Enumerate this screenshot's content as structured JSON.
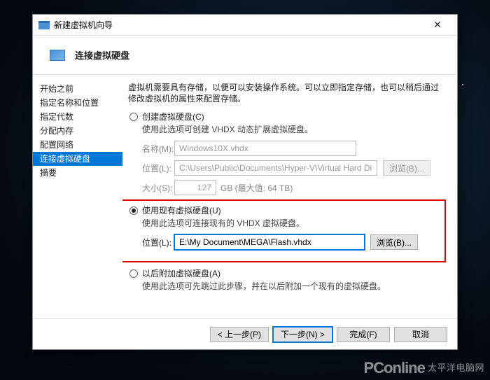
{
  "window": {
    "title": "新建虚拟机向导"
  },
  "header": {
    "title": "连接虚拟硬盘"
  },
  "sidebar": {
    "items": [
      {
        "label": "开始之前"
      },
      {
        "label": "指定名称和位置"
      },
      {
        "label": "指定代数"
      },
      {
        "label": "分配内存"
      },
      {
        "label": "配置网络"
      },
      {
        "label": "连接虚拟硬盘"
      },
      {
        "label": "摘要"
      }
    ]
  },
  "content": {
    "description": "虚拟机需要具有存储，以便可以安装操作系统。可以立即指定存储，也可以稍后通过修改虚拟机的属性来配置存储。",
    "opt_create": {
      "label": "创建虚拟硬盘(C)",
      "desc": "使用此选项可创建 VHDX 动态扩展虚拟硬盘。",
      "name_label": "名称(M):",
      "name_value": "Windows10X.vhdx",
      "loc_label": "位置(L):",
      "loc_value": "C:\\Users\\Public\\Documents\\Hyper-V\\Virtual Hard Disks\\",
      "browse": "浏览(B)...",
      "size_label": "大小(S):",
      "size_value": "127",
      "size_unit": "GB (最大值: 64 TB)"
    },
    "opt_use": {
      "label": "使用现有虚拟硬盘(U)",
      "desc": "使用此选项可连接现有的 VHDX 虚拟硬盘。",
      "loc_label": "位置(L):",
      "loc_value": "E:\\My Document\\MEGA\\Flash.vhdx",
      "browse": "浏览(B)..."
    },
    "opt_later": {
      "label": "以后附加虚拟硬盘(A)",
      "desc": "使用此选项可先跳过此步骤，并在以后附加一个现有的虚拟硬盘。"
    }
  },
  "footer": {
    "back": "< 上一步(P)",
    "next": "下一步(N) >",
    "finish": "完成(F)",
    "cancel": "取消"
  },
  "watermark": {
    "brand": "PConline",
    "sub": "太平洋电脑网"
  }
}
